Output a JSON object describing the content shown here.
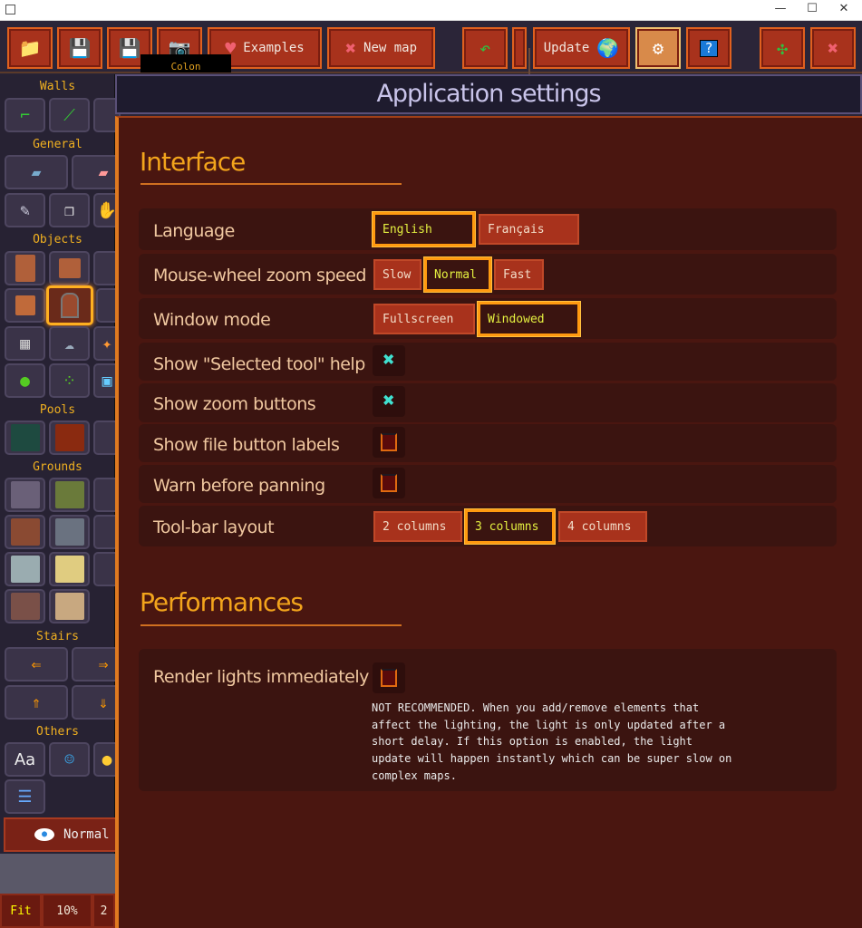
{
  "window": {
    "min": "—",
    "max": "☐",
    "close": "✕"
  },
  "toolbar": {
    "examples": "Examples",
    "new_map": "New map",
    "update": "Update",
    "tooltip": "Colon"
  },
  "sidebar": {
    "walls": "Walls",
    "general": "General",
    "objects": "Objects",
    "pools": "Pools",
    "grounds": "Grounds",
    "stairs": "Stairs",
    "others": "Others",
    "text_tool": "Aa",
    "view_mode": "Normal",
    "zoom": [
      "Fit",
      "10%",
      "2"
    ]
  },
  "dialog": {
    "title": "Application settings"
  },
  "interface": {
    "heading": "Interface",
    "language": {
      "label": "Language",
      "options": [
        "English",
        "Français"
      ],
      "selected": "English"
    },
    "zoom_speed": {
      "label": "Mouse-wheel zoom speed",
      "options": [
        "Slow",
        "Normal",
        "Fast"
      ],
      "selected": "Normal"
    },
    "window_mode": {
      "label": "Window mode",
      "options": [
        "Fullscreen",
        "Windowed"
      ],
      "selected": "Windowed"
    },
    "selected_tool_help": {
      "label": "Show \"Selected tool\" help",
      "checked": true
    },
    "zoom_buttons": {
      "label": "Show zoom buttons",
      "checked": true
    },
    "file_labels": {
      "label": "Show file button labels",
      "checked": false
    },
    "warn_panning": {
      "label": "Warn before panning",
      "checked": false
    },
    "toolbar_layout": {
      "label": "Tool-bar layout",
      "options": [
        "2 columns",
        "3 columns",
        "4 columns"
      ],
      "selected": "3 columns"
    }
  },
  "performances": {
    "heading": "Performances",
    "render_lights": {
      "label": "Render lights immediately",
      "checked": false,
      "note": "NOT RECOMMENDED. When you add/remove elements that affect the lighting, the light is only updated after a short delay. If this option is enabled, the light update will happen instantly which can be super slow on complex maps."
    }
  },
  "colors": {
    "accent": "#f2a41c",
    "button": "#a8321c",
    "panel": "#4a1610",
    "selected_border": "#ff9a10"
  }
}
